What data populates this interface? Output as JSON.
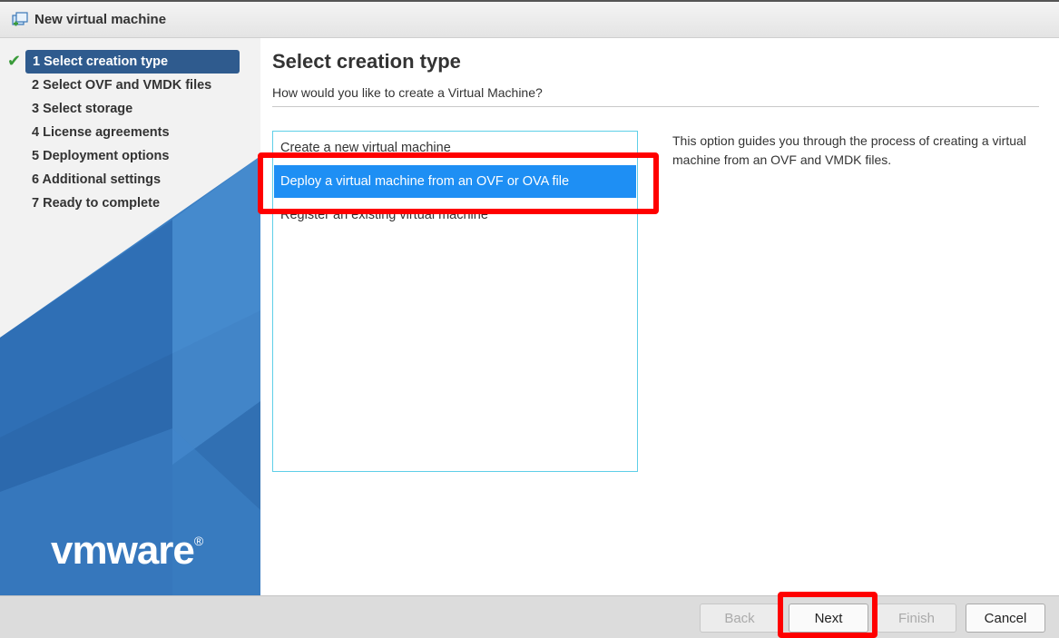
{
  "window": {
    "title": "New virtual machine"
  },
  "steps": [
    {
      "label": "1 Select creation type",
      "done": true,
      "active": true
    },
    {
      "label": "2 Select OVF and VMDK files"
    },
    {
      "label": "3 Select storage"
    },
    {
      "label": "4 License agreements"
    },
    {
      "label": "5 Deployment options"
    },
    {
      "label": "6 Additional settings"
    },
    {
      "label": "7 Ready to complete"
    }
  ],
  "brand": {
    "logo_text": "vmware",
    "logo_mark": "®"
  },
  "main": {
    "heading": "Select creation type",
    "subheading": "How would you like to create a Virtual Machine?",
    "options": [
      "Create a new virtual machine",
      "Deploy a virtual machine from an OVF or OVA file",
      "Register an existing virtual machine"
    ],
    "selected_option": "Deploy a virtual machine from an OVF or OVA file",
    "description": "This option guides you through the process of creating a virtual machine from an OVF and VMDK files."
  },
  "footer": {
    "back_label": "Back",
    "next_label": "Next",
    "finish_label": "Finish",
    "cancel_label": "Cancel"
  },
  "colors": {
    "active_step": "#2f5b8e",
    "selected_option": "#1e8ff4",
    "highlight": "#ff0000",
    "check": "#3a9b3a"
  }
}
